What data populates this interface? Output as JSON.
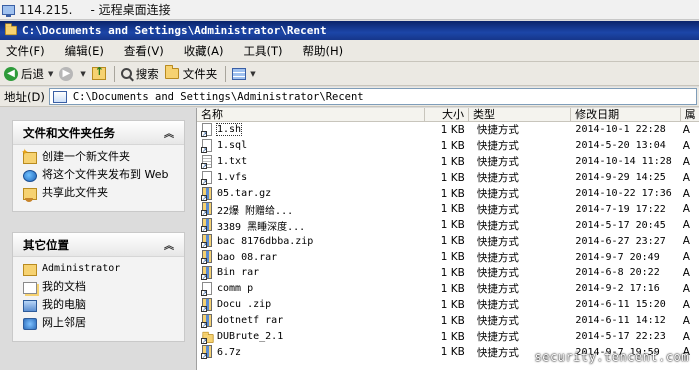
{
  "rdp": {
    "ip": "114.215.",
    "title": "- 远程桌面连接"
  },
  "window": {
    "title": "C:\\Documents and Settings\\Administrator\\Recent"
  },
  "menu": [
    "文件(F)",
    "编辑(E)",
    "查看(V)",
    "收藏(A)",
    "工具(T)",
    "帮助(H)"
  ],
  "toolbar": {
    "back": "后退",
    "search": "搜索",
    "folders": "文件夹"
  },
  "address": {
    "label": "地址(D)",
    "value": "C:\\Documents and Settings\\Administrator\\Recent"
  },
  "tasks_panel": {
    "title": "文件和文件夹任务",
    "items": [
      "创建一个新文件夹",
      "将这个文件夹发布到 Web",
      "共享此文件夹"
    ]
  },
  "places_panel": {
    "title": "其它位置",
    "items": [
      "Administrator",
      "我的文档",
      "我的电脑",
      "网上邻居"
    ]
  },
  "columns": {
    "name": "名称",
    "size": "大小",
    "type": "类型",
    "date": "修改日期",
    "attr": "属"
  },
  "files": [
    {
      "name": "1.sh",
      "size": "1 KB",
      "type": "快捷方式",
      "date": "2014-10-1 22:28",
      "attr": "A",
      "icon": "shortcut-icon"
    },
    {
      "name": "1.sql",
      "size": "1 KB",
      "type": "快捷方式",
      "date": "2014-5-20 13:04",
      "attr": "A",
      "icon": "shortcut-icon"
    },
    {
      "name": "1.txt",
      "size": "1 KB",
      "type": "快捷方式",
      "date": "2014-10-14 11:28",
      "attr": "A",
      "icon": "text-shortcut-icon"
    },
    {
      "name": "1.vfs",
      "size": "1 KB",
      "type": "快捷方式",
      "date": "2014-9-29 14:25",
      "attr": "A",
      "icon": "shortcut-icon"
    },
    {
      "name": "05.tar.gz",
      "size": "1 KB",
      "type": "快捷方式",
      "date": "2014-10-22 17:36",
      "attr": "A",
      "icon": "archive-shortcut-icon"
    },
    {
      "name": "22爆 附赠给...",
      "size": "1 KB",
      "type": "快捷方式",
      "date": "2014-7-19 17:22",
      "attr": "A",
      "icon": "archive-shortcut-icon"
    },
    {
      "name": "3389 黑睡深度...",
      "size": "1 KB",
      "type": "快捷方式",
      "date": "2014-5-17 20:45",
      "attr": "A",
      "icon": "archive-shortcut-icon"
    },
    {
      "name": "bac 8176dbba.zip",
      "size": "1 KB",
      "type": "快捷方式",
      "date": "2014-6-27 23:27",
      "attr": "A",
      "icon": "archive-shortcut-icon"
    },
    {
      "name": "bao 08.rar",
      "size": "1 KB",
      "type": "快捷方式",
      "date": "2014-9-7 20:49",
      "attr": "A",
      "icon": "archive-shortcut-icon"
    },
    {
      "name": "Bin rar",
      "size": "1 KB",
      "type": "快捷方式",
      "date": "2014-6-8 20:22",
      "attr": "A",
      "icon": "archive-shortcut-icon"
    },
    {
      "name": "comm p",
      "size": "1 KB",
      "type": "快捷方式",
      "date": "2014-9-2 17:16",
      "attr": "A",
      "icon": "shortcut-icon"
    },
    {
      "name": "Docu .zip",
      "size": "1 KB",
      "type": "快捷方式",
      "date": "2014-6-11 15:20",
      "attr": "A",
      "icon": "archive-shortcut-icon"
    },
    {
      "name": "dotnetf rar",
      "size": "1 KB",
      "type": "快捷方式",
      "date": "2014-6-11 14:12",
      "attr": "A",
      "icon": "archive-shortcut-icon"
    },
    {
      "name": "DUBrute_2.1",
      "size": "1 KB",
      "type": "快捷方式",
      "date": "2014-5-17 22:23",
      "attr": "A",
      "icon": "folder-shortcut-icon"
    },
    {
      "name": "6.7z",
      "size": "1 KB",
      "type": "快捷方式",
      "date": "2014-9-7 19:59",
      "attr": "A",
      "icon": "archive-shortcut-icon"
    }
  ],
  "watermark": "security.tencent.com"
}
